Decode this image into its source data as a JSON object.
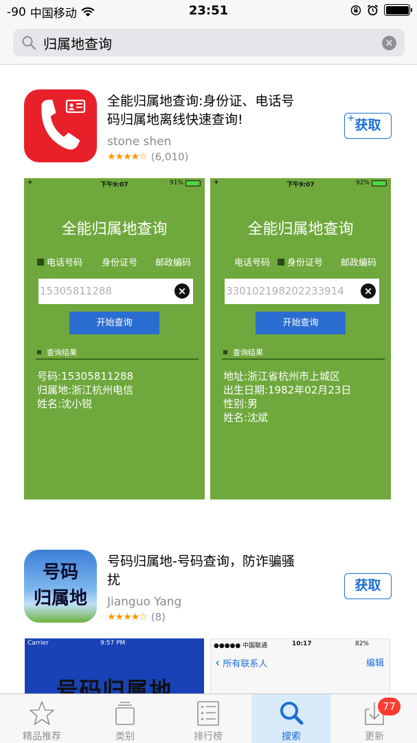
{
  "status_bar": {
    "signal": "-90",
    "carrier": "中国移动",
    "time": "23:51"
  },
  "search": {
    "query": "归属地查询",
    "placeholder": ""
  },
  "apps": [
    {
      "title_line1": "全能归属地查询:身份证、电话号",
      "title_line2": "码归属地离线快速查询!",
      "developer": "stone shen",
      "stars": "★★★★☆",
      "rating_count": "(6,010)",
      "get_label": "获取",
      "get_plus": "+",
      "screenshots": [
        {
          "carrier": "✈",
          "time": "下午9:07",
          "battery": "91%",
          "title": "全能归属地查询",
          "options": [
            "电话号码",
            "身份证号",
            "邮政编码"
          ],
          "input_value": "15305811288",
          "button": "开始查询",
          "result_label": "查询结果",
          "results": [
            "号码:15305811288",
            "归属地:浙江杭州电信",
            "姓名:沈小锐"
          ]
        },
        {
          "carrier": "✈",
          "time": "下午9:07",
          "battery": "92%",
          "title": "全能归属地查询",
          "options": [
            "电话号码",
            "身份证号",
            "邮政编码"
          ],
          "input_value": "330102198202233914",
          "button": "开始查询",
          "result_label": "查询结果",
          "results": [
            "地址:浙江省杭州市上城区",
            "出生日期:1982年02月23日",
            "性别:男",
            "姓名:沈斌"
          ]
        }
      ]
    },
    {
      "title_line1": "号码归属地-号码查询，防诈骗骚",
      "title_line2": "扰",
      "developer": "Jianguo Yang",
      "stars": "★★★★☆",
      "rating_count": "(8)",
      "get_label": "获取",
      "icon_text_1": "号码",
      "icon_text_2": "归属地",
      "screenshots": [
        {
          "carrier": "Carrier",
          "time": "9:57 PM",
          "big_text": "号码归属地"
        },
        {
          "carrier": "●●●●● 中国联通",
          "time": "10:17",
          "battery": "82%",
          "nav_back": "所有联系人",
          "nav_edit": "编辑"
        }
      ]
    }
  ],
  "tab_bar": {
    "tabs": [
      {
        "label": "精品推荐",
        "icon": "star-icon"
      },
      {
        "label": "类别",
        "icon": "categories-icon"
      },
      {
        "label": "排行榜",
        "icon": "list-icon"
      },
      {
        "label": "搜索",
        "icon": "search-icon"
      },
      {
        "label": "更新",
        "icon": "download-icon"
      }
    ],
    "active": "搜索",
    "updates_badge": "77"
  },
  "colors": {
    "accent": "#1a6fd8",
    "screenshot_green": "#6fa83c",
    "star": "#ff9500",
    "badge": "#ff3b30"
  }
}
